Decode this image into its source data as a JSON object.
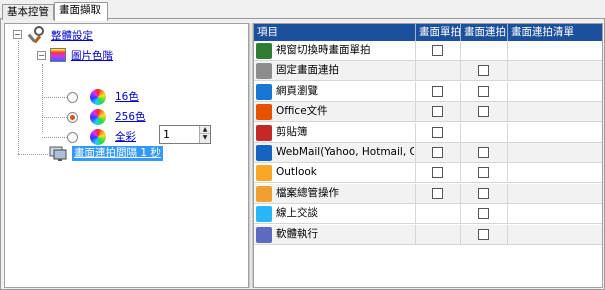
{
  "tabs": [
    "基本控管",
    "畫面擷取"
  ],
  "tree": {
    "root_label": "整體設定",
    "color_group_label": "圖片色階",
    "color_options": [
      {
        "label": "16色",
        "selected": false
      },
      {
        "label": "256色",
        "selected": true
      },
      {
        "label": "全彩",
        "selected": false
      }
    ],
    "interval_label": "畫面連拍間隔 1 秒",
    "interval_value": "1"
  },
  "grid": {
    "columns": [
      "項目",
      "畫面單拍",
      "畫面連拍",
      "畫面連拍清單"
    ],
    "rows": [
      {
        "label": "視窗切換時畫面單拍",
        "icon": "window-switch-icon",
        "single": true,
        "continuous": false
      },
      {
        "label": "固定畫面連拍",
        "icon": "clock-icon",
        "single": false,
        "continuous": true
      },
      {
        "label": "網頁瀏覽",
        "icon": "ie-browser-icon",
        "single": true,
        "continuous": true
      },
      {
        "label": "Office文件",
        "icon": "office-document-icon",
        "single": true,
        "continuous": true
      },
      {
        "label": "剪貼簿",
        "icon": "clipboard-icon",
        "single": true,
        "continuous": false
      },
      {
        "label": "WebMail(Yahoo, Hotmail, Gm",
        "icon": "webmail-icon",
        "single": true,
        "continuous": true
      },
      {
        "label": "Outlook",
        "icon": "outlook-icon",
        "single": true,
        "continuous": true
      },
      {
        "label": "檔案總管操作",
        "icon": "file-explorer-icon",
        "single": true,
        "continuous": true
      },
      {
        "label": "線上交談",
        "icon": "chat-icon",
        "single": false,
        "continuous": true
      },
      {
        "label": "軟體執行",
        "icon": "software-run-icon",
        "single": false,
        "continuous": true
      }
    ]
  },
  "colors": {
    "header_bg": "#1c4f9c",
    "link": "#0000cc",
    "selection": "#3399ff"
  }
}
